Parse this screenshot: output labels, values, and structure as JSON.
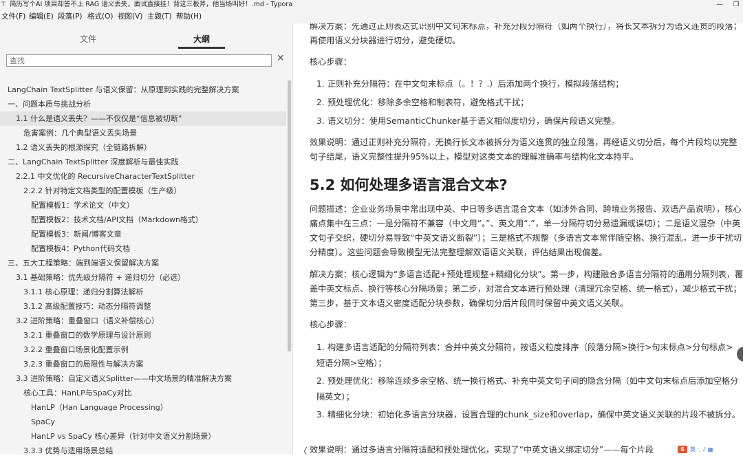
{
  "window": {
    "title": "简历写个AI 项目却答不上 RAG 语义丢失，面试直接挂！背这三板斧，他当场叫好！.md - Typora",
    "minimize_glyph": "—",
    "restore_glyph": "❐"
  },
  "menu": [
    "文件(F)",
    "编辑(E)",
    "段落(P)",
    "格式(O)",
    "视图(V)",
    "主题(T)",
    "帮助(H)"
  ],
  "sidebar": {
    "tabs": [
      {
        "label": "文件"
      },
      {
        "label": "大纲"
      }
    ],
    "search_placeholder": "查找",
    "clear_glyph": "✕",
    "outline": [
      {
        "text": "LangChain TextSplitter 与语义保留：从原理到实践的完整解决方案"
      },
      {
        "text": "一、问题本质与挑战分析"
      },
      {
        "text": "1.1 什么是语义丢失？——不仅仅是“信息被切断”"
      },
      {
        "text": "危害案例：几个典型语义丢失场景"
      },
      {
        "text": "1.2 语义丢失的根源探究（全链路拆解）"
      },
      {
        "text": "二、LangChain TextSplitter 深度解析与最佳实践"
      },
      {
        "text": "2.2.1 中文优化的 RecursiveCharacterTextSplitter"
      },
      {
        "text": "2.2.2 针对特定文档类型的配置模板（生产级）"
      },
      {
        "text": "配置模板1：学术论文（中文）"
      },
      {
        "text": "配置模板2：技术文档/API文档（Markdown格式）"
      },
      {
        "text": "配置模板3：新闻/博客文章"
      },
      {
        "text": "配置模板4：Python代码文档"
      },
      {
        "text": "三、五大工程策略：端到端语义保留解决方案"
      },
      {
        "text": "3.1 基础策略：优先级分隔符 + 递归切分（必选）"
      },
      {
        "text": "3.1.1 核心原理：递归分割算法解析"
      },
      {
        "text": "3.1.2 高级配置技巧：动态分隔符调整"
      },
      {
        "text": "3.2 进阶策略：重叠窗口（语义补偿核心）"
      },
      {
        "text": "3.2.1 重叠窗口的数学原理与设计原则"
      },
      {
        "text": "3.2.2 重叠窗口场景化配置示例"
      },
      {
        "text": "3.2.3 重叠窗口的局限性与解决方案"
      },
      {
        "text": "3.3 进阶策略：自定义语义Splitter——中文场景的精准解决方案"
      },
      {
        "text": "核心工具：HanLP与SpaCy对比"
      },
      {
        "text": "HanLP（Han Language Processing）"
      },
      {
        "text": "SpaCy"
      },
      {
        "text": "HanLP vs SpaCy 核心差异（针对中文语义分割场景）"
      },
      {
        "text": "3.3.3 优势与适用场景总结"
      }
    ]
  },
  "content": {
    "p1": "解决方案：先通过正则表达式识别中文句末标点，补充分段分隔符（如两个换行），将长文本拆分为语义连贯的段落；再使用语义分块器进行切分，避免硬切。",
    "steps_label_1": "核心步骤：",
    "list1": [
      {
        "num": "1.",
        "text": "正则补充分隔符：在中文句末标点（。！？.）后添加两个换行，模拟段落结构；"
      },
      {
        "num": "2.",
        "text": "预处理优化：移除多余空格和制表符，避免格式干扰；"
      },
      {
        "num": "3.",
        "text": "语义切分：使用SemanticChunker基于语义相似度切分，确保片段语义完整。"
      }
    ],
    "effect1": "效果说明：通过正则补充分隔符，无换行长文本被拆分为语义连贯的独立段落，再经语义切分后，每个片段均以完整句子结尾，语义完整性提升95%以上，模型对这类文本的理解准确率与结构化文本持平。",
    "heading": "5.2 如何处理多语言混合文本?",
    "problem": "问题描述：企业业务场景中常出现中英、中日等多语言混合文本（如涉外合同、跨境业务报告、双语产品说明），核心痛点集中在三点：一是分隔符不兼容（中文用“。”、英文用“.”，单一分隔符切分易遗漏或误切）；二是语义混杂（中英文句子交织，硬切分易导致“中英文语义断裂”）；三是格式不规整（多语言文本常伴随空格、换行混乱，进一步干扰切分精度）。这些问题会导致模型无法完整理解双语语义关联，评估结果出现偏差。",
    "solution": "解决方案：核心逻辑为“多语言适配+预处理规整+精细化分块”。第一步，构建融合多语言分隔符的通用分隔列表，覆盖中英文标点、换行等核心分隔场景；第二步，对混合文本进行预处理（清理冗余空格、统一格式），减少格式干扰；第三步，基于文本语义密度适配分块参数，确保切分后片段同时保留中英文语义关联。",
    "steps_label_2": "核心步骤：",
    "list2": [
      {
        "num": "1.",
        "text": "构建多语言适配的分隔符列表：合并中英文分隔符，按语义粒度排序（段落分隔>换行>句末标点>分句标点>短语分隔>空格）；"
      },
      {
        "num": "2.",
        "text": "预处理优化：移除连续多余空格、统一换行格式、补充中英文句子间的隐含分隔（如中文句末标点后添加空格分隔英文）；"
      },
      {
        "num": "3.",
        "text": "精细化分块：初始化多语言分块器，设置合理的chunk_size和overlap，确保中英文语义关联的片段不被拆分。"
      }
    ],
    "effect2": "效果说明：通过多语言分隔符适配和预处理优化，实现了“中英文语义绑定切分”——每个片段",
    "back_glyph": "〈"
  },
  "ime": {
    "logo": "S",
    "text": "英 ·, ♪ ▦"
  },
  "colors": {
    "sidebar_bg": "#f4f4f4",
    "active_row": "#e4e4e4",
    "text": "#333333",
    "ime_logo": "#e8542c"
  }
}
